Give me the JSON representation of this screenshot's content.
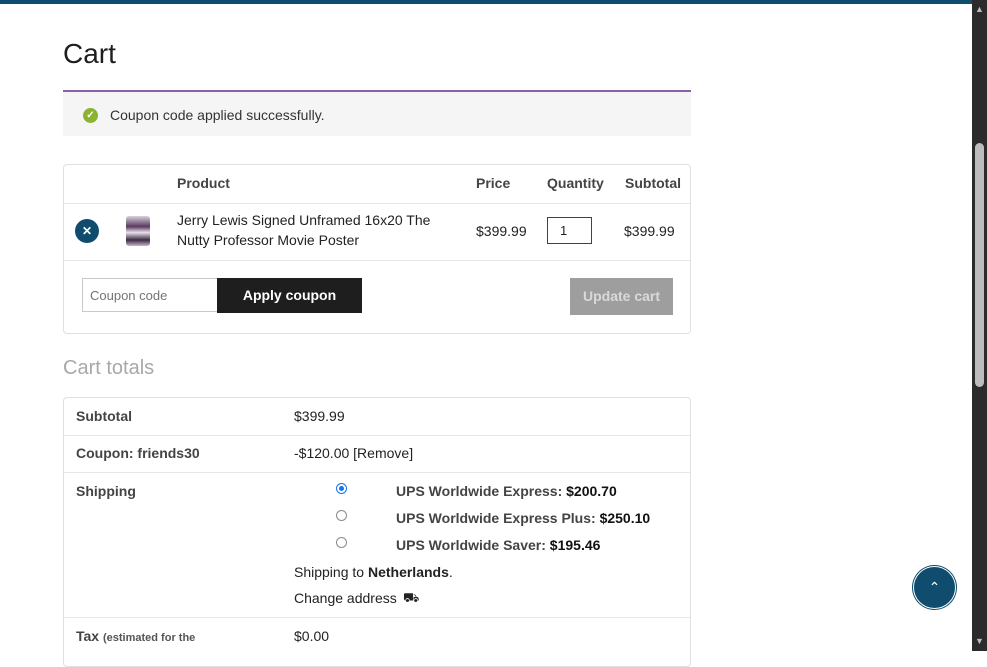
{
  "page": {
    "title": "Cart"
  },
  "notice": {
    "message": "Coupon code applied successfully.",
    "icon": "check-circle-icon",
    "accent": "#8d5fa3"
  },
  "cart": {
    "headers": {
      "product": "Product",
      "price": "Price",
      "quantity": "Quantity",
      "subtotal": "Subtotal"
    },
    "items": [
      {
        "name_line1": "Jerry Lewis Signed Unframed 16x20 The",
        "name_line2": "Nutty Professor Movie Poster",
        "price": "$399.99",
        "quantity": "1",
        "subtotal": "$399.99"
      }
    ],
    "coupon_placeholder": "Coupon code",
    "apply_coupon_label": "Apply coupon",
    "update_cart_label": "Update cart"
  },
  "totals": {
    "title": "Cart totals",
    "subtotal_label": "Subtotal",
    "subtotal_value": "$399.99",
    "coupon_label": "Coupon: friends30",
    "coupon_value": "-$120.00",
    "coupon_remove": "[Remove]",
    "shipping_label": "Shipping",
    "shipping_options": [
      {
        "name": "UPS Worldwide Express:",
        "price": "$200.70",
        "selected": true
      },
      {
        "name": "UPS Worldwide Express Plus:",
        "price": "$250.10",
        "selected": false
      },
      {
        "name": "UPS Worldwide Saver:",
        "price": "$195.46",
        "selected": false
      }
    ],
    "shipping_to_prefix": "Shipping to",
    "shipping_country": "Netherlands",
    "shipping_to_suffix": ".",
    "change_address": "Change address",
    "tax_label": "Tax",
    "tax_note": "(estimated for the",
    "tax_value": "$0.00"
  },
  "colors": {
    "brand": "#0f4c6e",
    "dark_button": "#1e1e1e",
    "success": "#8ab42e"
  }
}
